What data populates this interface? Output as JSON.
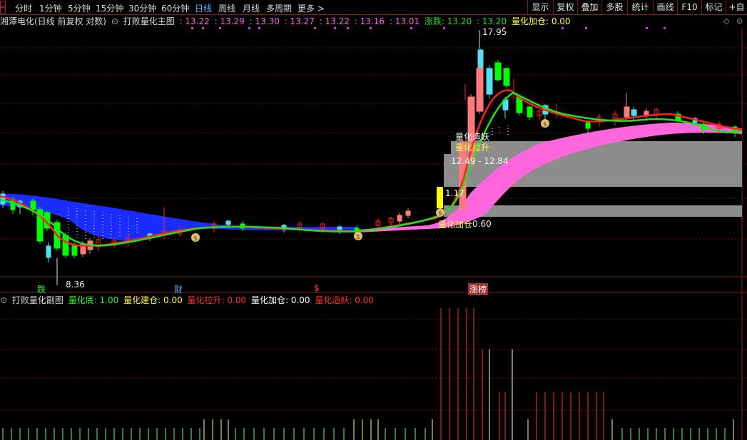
{
  "periods": [
    "分时",
    "1分钟",
    "5分钟",
    "15分钟",
    "30分钟",
    "60分钟",
    "日线",
    "周线",
    "月线",
    "多周期",
    "更多 >"
  ],
  "active_period": "日线",
  "right_buttons": [
    "显示",
    "复权",
    "叠加",
    "多股",
    "统计",
    "画线",
    "F10",
    "标记",
    "+自选"
  ],
  "info": {
    "stock": "湘潭电化(日线 前复权 对数)",
    "indicator": "打败量化主图",
    "values": [
      ": 13.22",
      ": 13.29",
      ": 13.30",
      ": 13.27",
      ": 13.22",
      ": 13.16",
      ": 13.01"
    ],
    "zhangdie_label": "涨跌: 13.20",
    "zhangdie_value": ": 13.20",
    "jiacang": "量化加仓: 0.00"
  },
  "sub": {
    "title": "打败量化副图",
    "di": "量化底: 1.00",
    "jiancang": "量化建仓: 0.00",
    "lasheng": "量化拉升: 0.00",
    "jiacang": "量化加仓: 0.00",
    "zaoyao": "量化造妖: 0.00"
  },
  "annotations": {
    "high": "17.95",
    "low": "8.36",
    "zaoyao": "量化造妖",
    "lasheng": "量化拉升",
    "range": "12.49 - 12.84",
    "jiacang": "量化加仓",
    "price_60": "0.60",
    "price_17": "1.17",
    "die": "跌",
    "cai": "财",
    "dollar": "$",
    "zhangting": "涨榜"
  },
  "colors": {
    "up": "#ff7b7b",
    "down": "#00ff00",
    "cyan": "#55e0f0",
    "ma_red": "#ff2020",
    "ma_green": "#20e020",
    "blue_band": "#1a2cff",
    "pink_band": "#ff66dd",
    "grid_red": "#7a1414"
  }
}
